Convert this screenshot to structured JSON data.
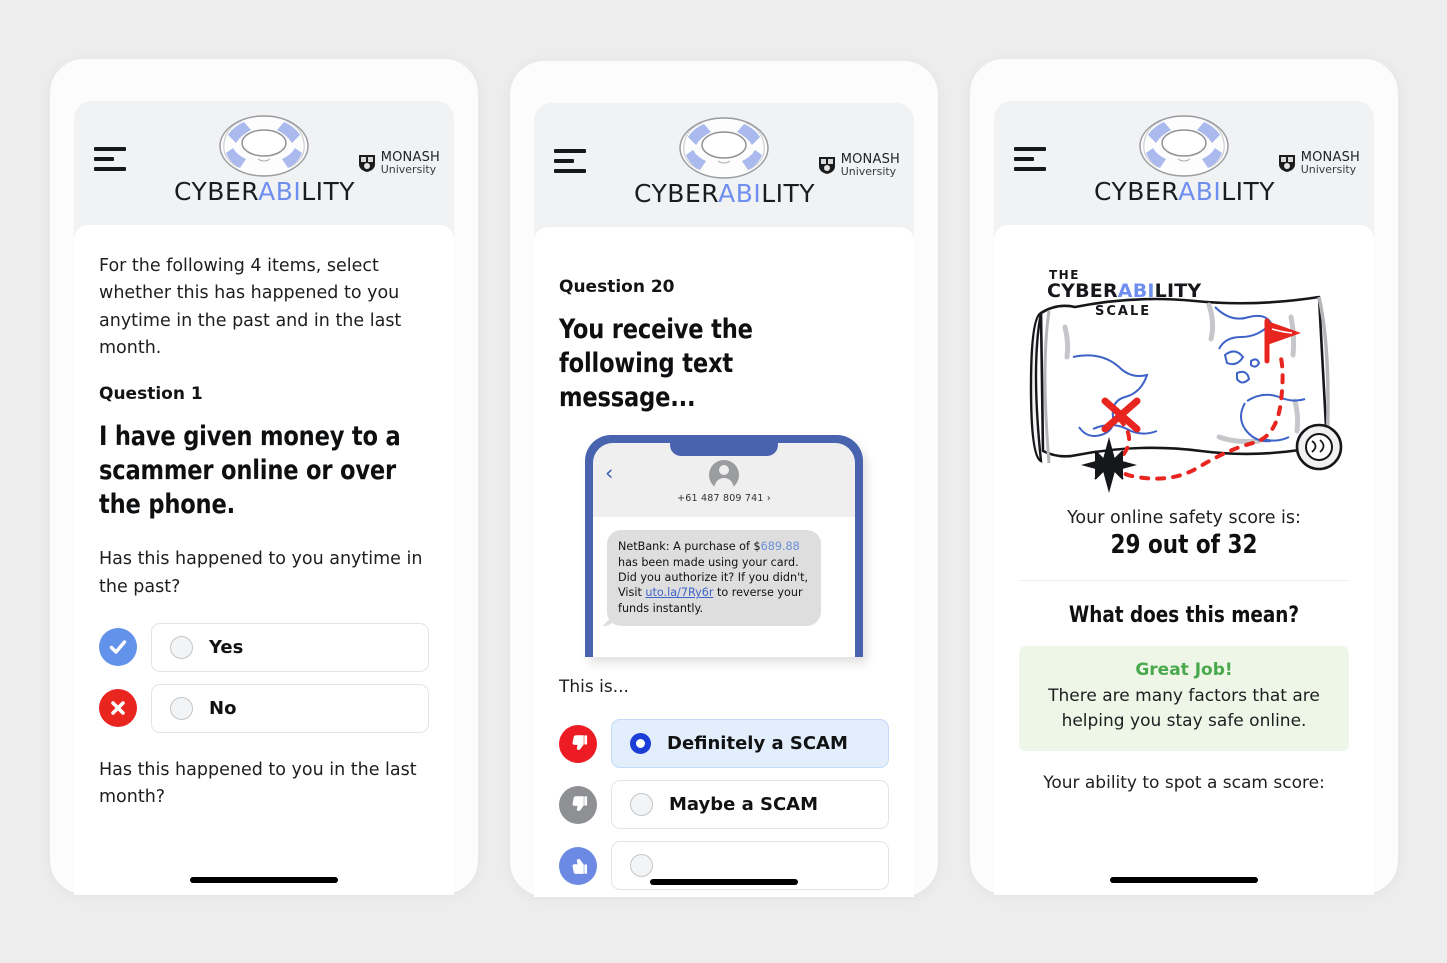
{
  "brand": {
    "name_part1": "CYBER",
    "name_highlight": "ABI",
    "name_part2": "LITY",
    "logo_icon": "lifebuoy-icon",
    "menu_icon": "hamburger-menu-icon",
    "university_line1": "MONASH",
    "university_line2": "University",
    "university_logo_icon": "monash-shield-icon",
    "highlight_color": "#6f8ff0"
  },
  "phone1": {
    "intro": "For the following 4 items, select whether this has happened to you anytime in the past and in the last month.",
    "question_label": "Question 1",
    "question_text": "I have given money to a scammer online or over the phone.",
    "prompt_past": "Has this happened to you anytime in the past?",
    "prompt_month": "Has this happened to you in the last month?",
    "options": [
      {
        "label": "Yes",
        "badge_icon": "check-circle-icon",
        "badge_color": "#6292ea",
        "selected": false
      },
      {
        "label": "No",
        "badge_icon": "x-circle-icon",
        "badge_color": "#e8251f",
        "selected": false
      }
    ]
  },
  "phone2": {
    "question_label": "Question 20",
    "question_text": "You receive the following text message...",
    "sms": {
      "back_icon": "chevron-left-icon",
      "avatar_icon": "person-avatar-icon",
      "sender": "+61 487 809 741 ›",
      "message_part1": "NetBank: A purchase of $",
      "message_amount": "689.88",
      "message_part2": " has been made using your card. Did you authorize it? If you didn't, Visit ",
      "message_link": "uto.la/7Ry6r",
      "message_part3": " to reverse your funds instantly.",
      "amount_color": "#6b8ed6",
      "link_color": "#3e63c8"
    },
    "prompt": "This is...",
    "options": [
      {
        "label": "Definitely a SCAM",
        "badge_icon": "thumbs-down-icon",
        "badge_color": "#ed1c24",
        "selected": true
      },
      {
        "label": "Maybe a SCAM",
        "badge_icon": "thumbs-down-icon",
        "badge_color": "#8e9093",
        "selected": false
      },
      {
        "label": "",
        "badge_icon": "thumbs-up-icon",
        "badge_color": "#6c8ae4",
        "selected": false
      }
    ]
  },
  "phone3": {
    "map": {
      "title_the": "THE",
      "title_cyber": "CYBER",
      "title_abi": "ABI",
      "title_lity": "LITY",
      "title_scale": "SCALE",
      "icon": "treasure-map-scroll-icon"
    },
    "score_caption": "Your online safety score is:",
    "score_value": "29 out of 32",
    "mean_heading": "What does this mean?",
    "result_title": "Great Job!",
    "result_body": "There are many factors that are helping you stay safe online.",
    "result_title_color": "#4aa84c",
    "result_bg_color": "#eef6e7",
    "tail_text": "Your ability to spot a scam score:"
  }
}
